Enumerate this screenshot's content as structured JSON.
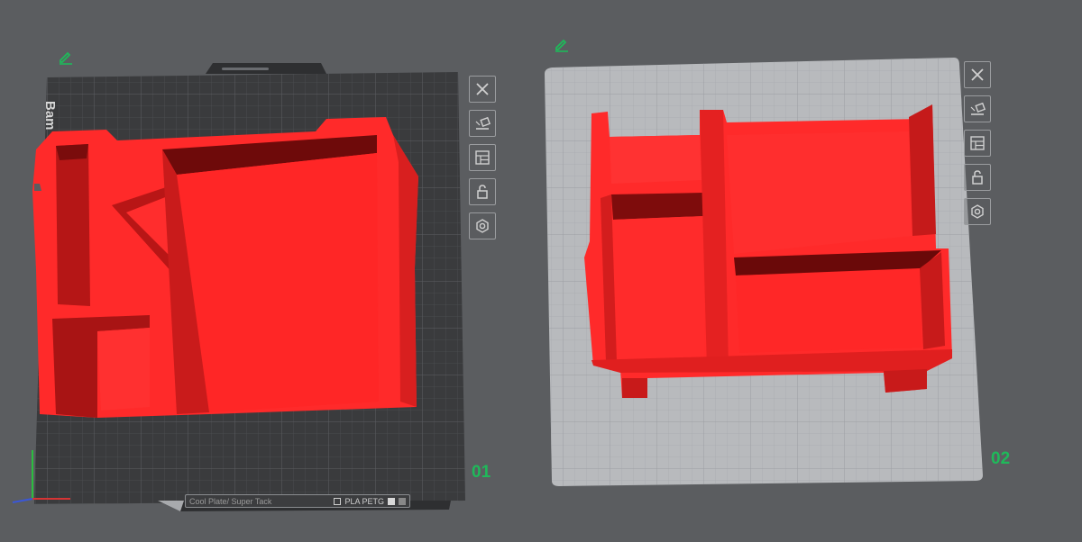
{
  "plates": [
    {
      "label": "01",
      "brand": "Bam",
      "status_name": "Cool Plate/ Super Tack",
      "status_type": "PLA PETG",
      "tools": [
        {
          "name": "close-icon"
        },
        {
          "name": "auto-orient-icon"
        },
        {
          "name": "arrange-icon"
        },
        {
          "name": "lock-icon"
        },
        {
          "name": "settings-icon"
        }
      ]
    },
    {
      "label": "02",
      "tools": [
        {
          "name": "close-icon"
        },
        {
          "name": "auto-orient-icon"
        },
        {
          "name": "arrange-icon"
        },
        {
          "name": "lock-icon"
        },
        {
          "name": "settings-icon"
        }
      ]
    }
  ],
  "colors": {
    "background": "#5b5d60",
    "plate_dark": "#3a3b3d",
    "plate_light": "#b8babd",
    "model_red": "#ff2222",
    "label_green": "#1fb95a"
  }
}
